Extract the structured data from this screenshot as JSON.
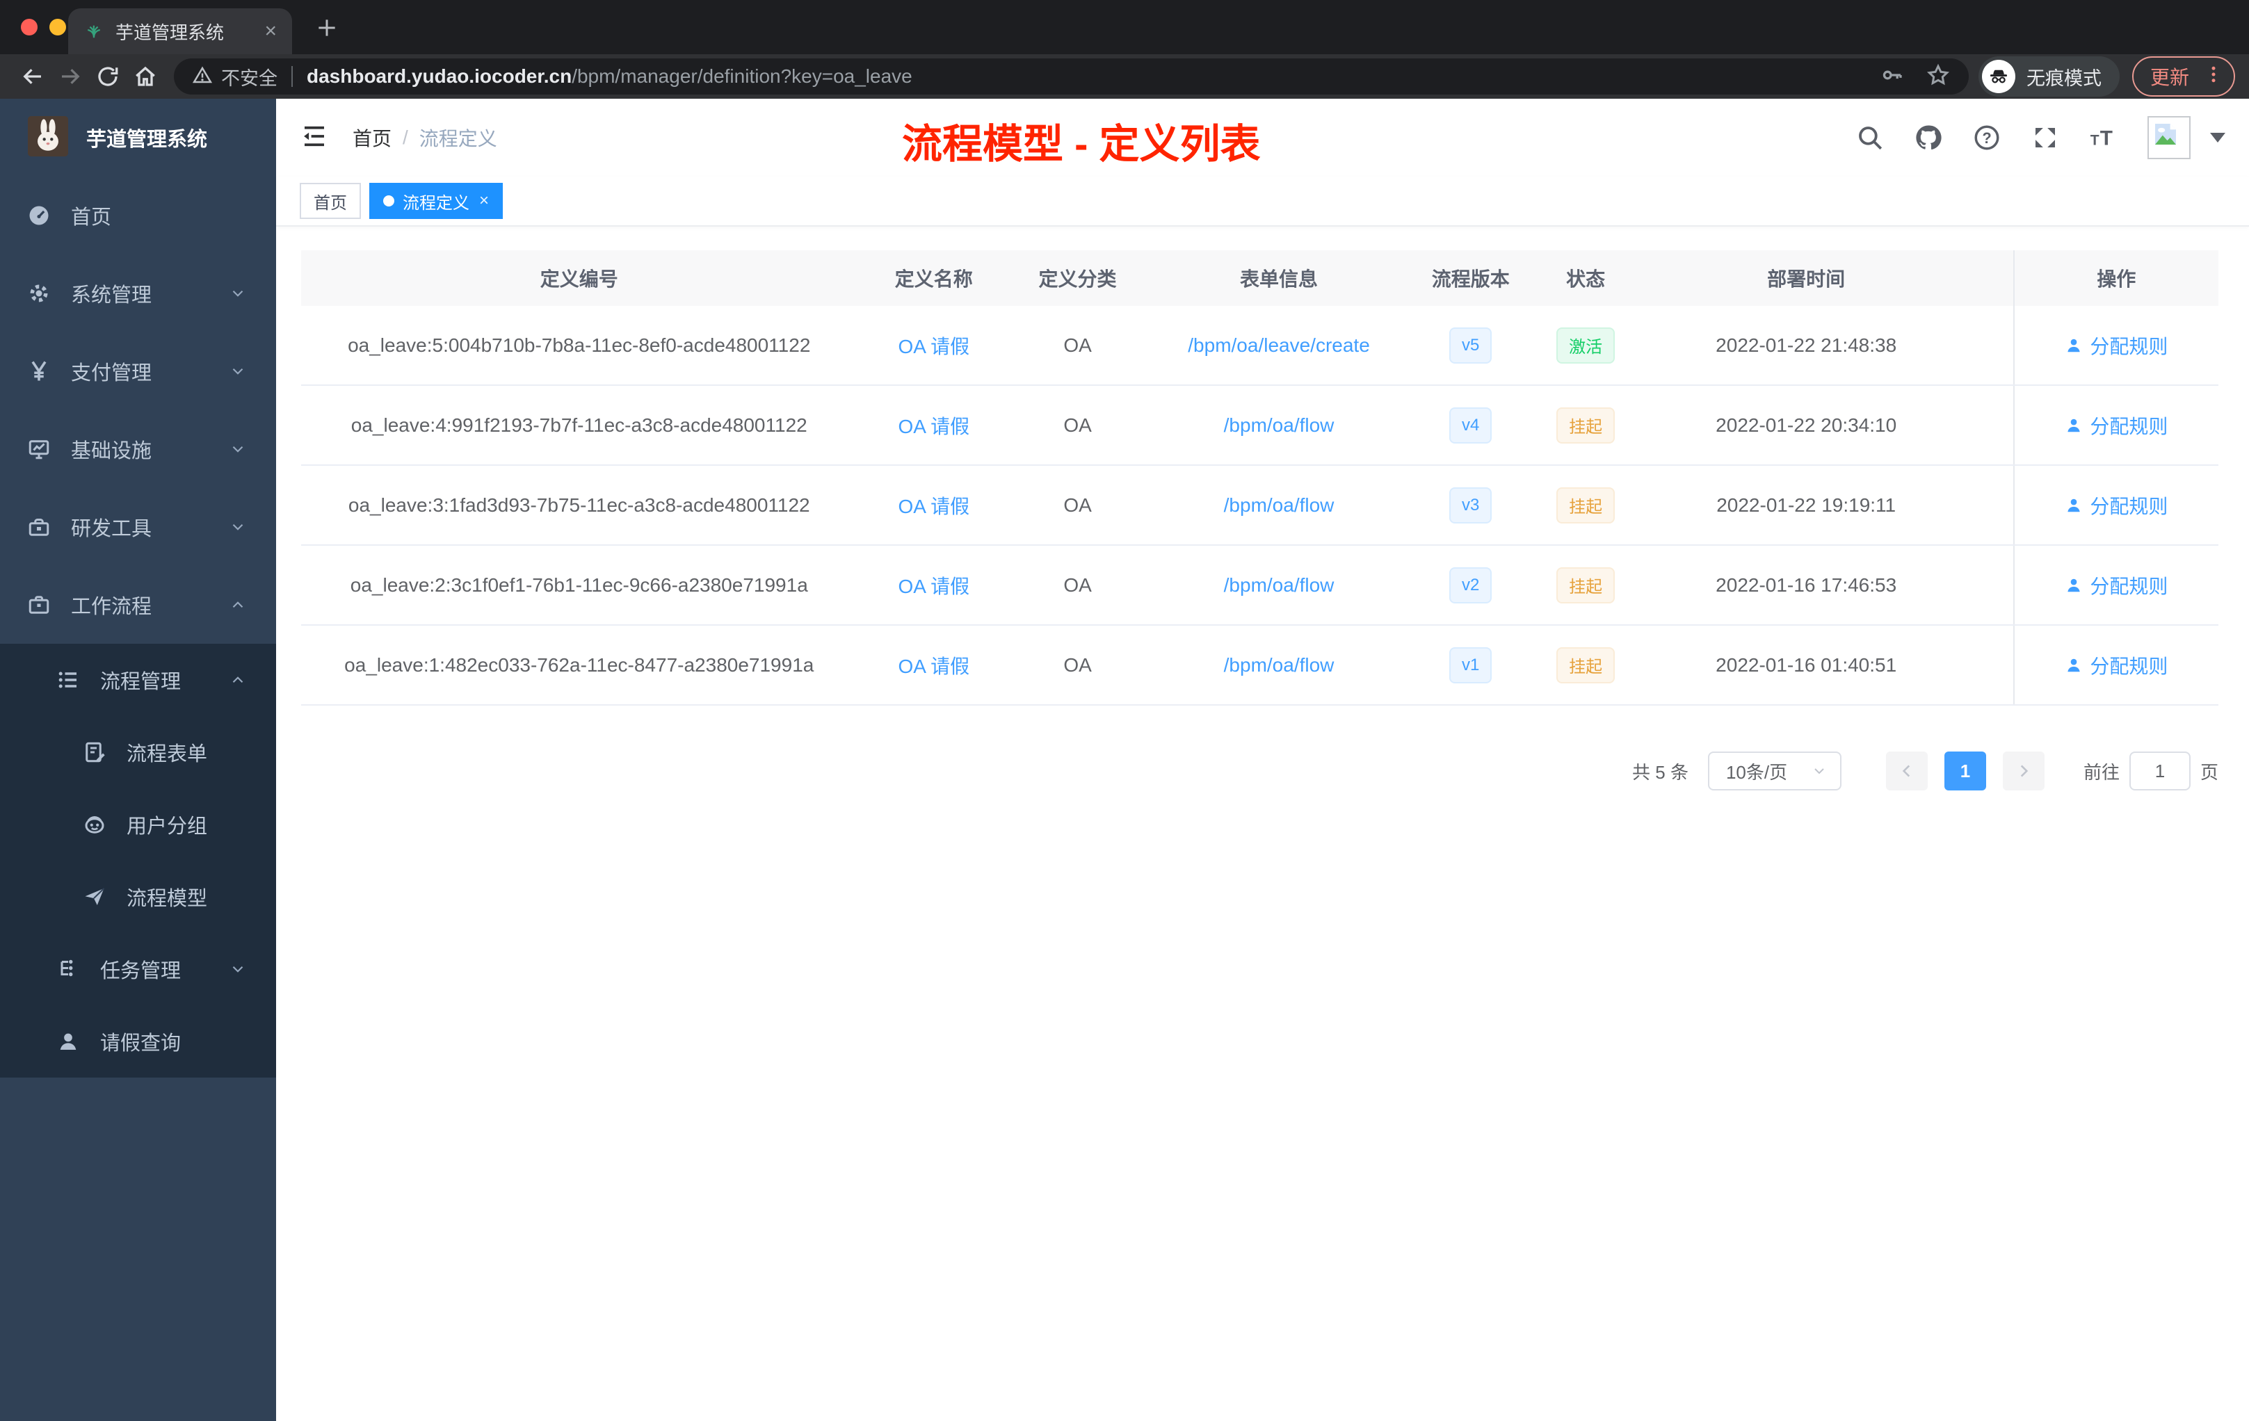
{
  "browser": {
    "tab_title": "芋道管理系统",
    "tab_close": "×",
    "new_tab": "+",
    "security_label": "不安全",
    "url_host": "dashboard.yudao.iocoder.cn",
    "url_path": "/bpm/manager/definition?key=oa_leave",
    "incognito_label": "无痕模式",
    "update_label": "更新"
  },
  "sidebar": {
    "logo_title": "芋道管理系统",
    "items": [
      {
        "label": "首页",
        "icon": "dashboard-icon"
      },
      {
        "label": "系统管理",
        "icon": "gear-icon"
      },
      {
        "label": "支付管理",
        "icon": "yen-icon"
      },
      {
        "label": "基础设施",
        "icon": "monitor-icon"
      },
      {
        "label": "研发工具",
        "icon": "toolbox-icon"
      },
      {
        "label": "工作流程",
        "icon": "briefcase-icon"
      },
      {
        "label": "流程管理",
        "icon": "list-tree-icon"
      },
      {
        "label": "流程表单",
        "icon": "form-icon"
      },
      {
        "label": "用户分组",
        "icon": "robot-icon"
      },
      {
        "label": "流程模型",
        "icon": "paper-plane-icon"
      },
      {
        "label": "任务管理",
        "icon": "org-tree-icon"
      },
      {
        "label": "请假查询",
        "icon": "user-icon"
      }
    ]
  },
  "header": {
    "breadcrumb_home": "首页",
    "breadcrumb_sep": "/",
    "breadcrumb_current": "流程定义",
    "annotation": "流程模型 - 定义列表"
  },
  "tags": {
    "home": "首页",
    "active": "流程定义",
    "close": "×"
  },
  "table": {
    "columns": [
      "定义编号",
      "定义名称",
      "定义分类",
      "表单信息",
      "流程版本",
      "状态",
      "部署时间",
      "操作"
    ],
    "rows": [
      {
        "id": "oa_leave:5:004b710b-7b8a-11ec-8ef0-acde48001122",
        "name": "OA 请假",
        "category": "OA",
        "form": "/bpm/oa/leave/create",
        "version": "v5",
        "status": "激活",
        "status_type": "success",
        "deploy_time": "2022-01-22 21:48:38",
        "action": "分配规则"
      },
      {
        "id": "oa_leave:4:991f2193-7b7f-11ec-a3c8-acde48001122",
        "name": "OA 请假",
        "category": "OA",
        "form": "/bpm/oa/flow",
        "version": "v4",
        "status": "挂起",
        "status_type": "warning",
        "deploy_time": "2022-01-22 20:34:10",
        "action": "分配规则"
      },
      {
        "id": "oa_leave:3:1fad3d93-7b75-11ec-a3c8-acde48001122",
        "name": "OA 请假",
        "category": "OA",
        "form": "/bpm/oa/flow",
        "version": "v3",
        "status": "挂起",
        "status_type": "warning",
        "deploy_time": "2022-01-22 19:19:11",
        "action": "分配规则"
      },
      {
        "id": "oa_leave:2:3c1f0ef1-76b1-11ec-9c66-a2380e71991a",
        "name": "OA 请假",
        "category": "OA",
        "form": "/bpm/oa/flow",
        "version": "v2",
        "status": "挂起",
        "status_type": "warning",
        "deploy_time": "2022-01-16 17:46:53",
        "action": "分配规则"
      },
      {
        "id": "oa_leave:1:482ec033-762a-11ec-8477-a2380e71991a",
        "name": "OA 请假",
        "category": "OA",
        "form": "/bpm/oa/flow",
        "version": "v1",
        "status": "挂起",
        "status_type": "warning",
        "deploy_time": "2022-01-16 01:40:51",
        "action": "分配规则"
      }
    ]
  },
  "pagination": {
    "total": "共 5 条",
    "page_size": "10条/页",
    "current_page": "1",
    "goto_label": "前往",
    "goto_value": "1",
    "page_unit": "页"
  },
  "colors": {
    "primary": "#409eff",
    "success": "#13ce66",
    "warning": "#e6a23c",
    "annotation_red": "#ff2400",
    "sidebar_bg": "#304156",
    "submenu_bg": "#1f2d3d"
  }
}
